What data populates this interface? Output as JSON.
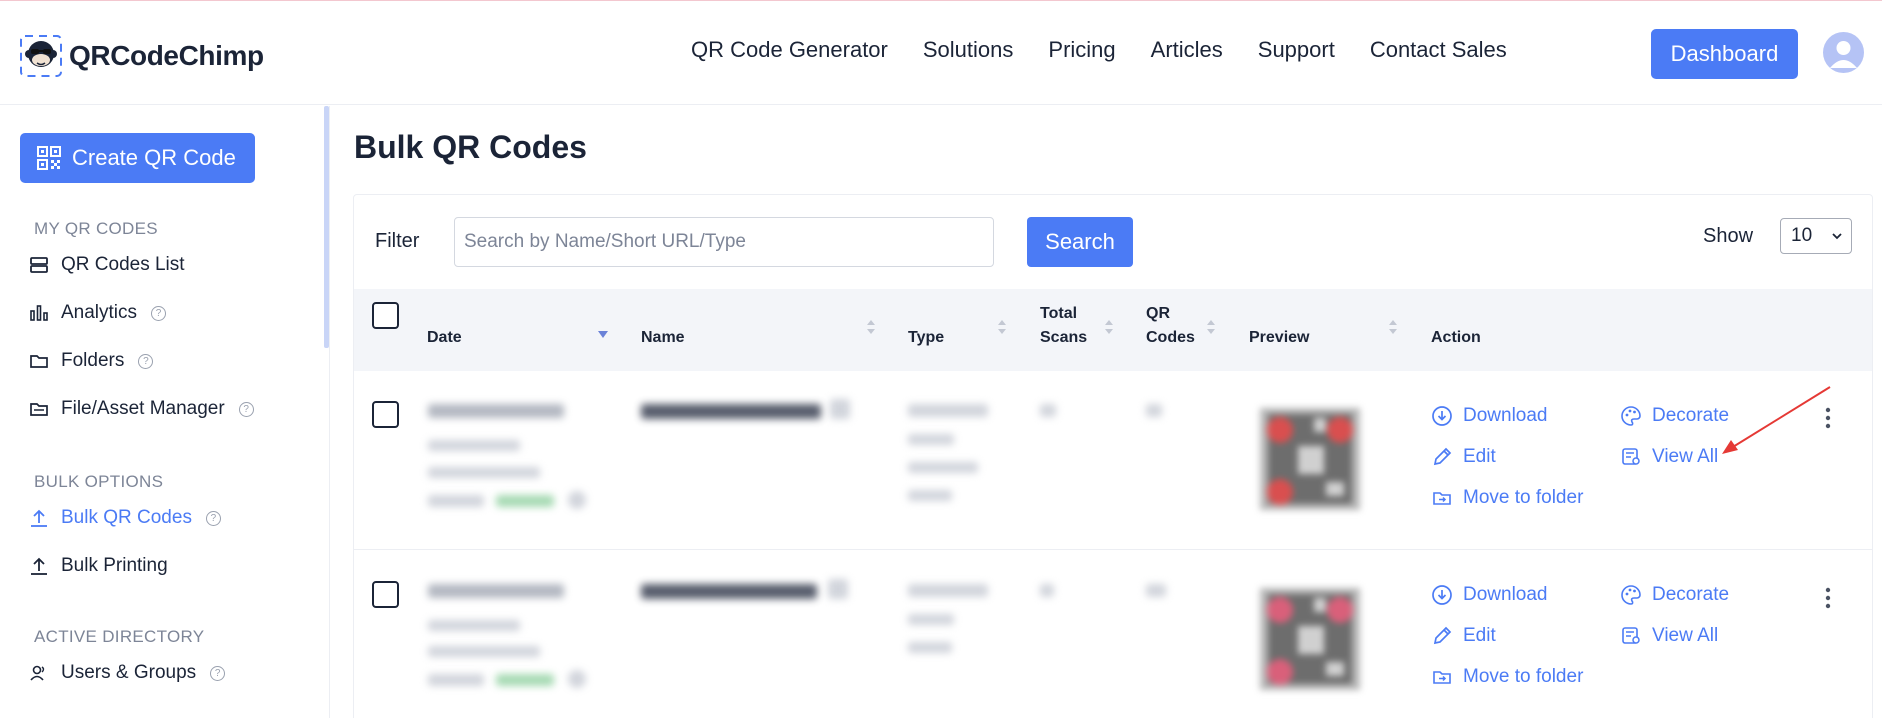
{
  "brand": {
    "name": "QRCodeChimp"
  },
  "nav": {
    "items": [
      "QR Code Generator",
      "Solutions",
      "Pricing",
      "Articles",
      "Support",
      "Contact Sales"
    ],
    "dashboard_label": "Dashboard"
  },
  "sidebar": {
    "create_label": "Create QR Code",
    "sections": [
      {
        "heading": "MY QR CODES",
        "items": [
          "QR Codes List",
          "Analytics",
          "Folders",
          "File/Asset Manager"
        ]
      },
      {
        "heading": "BULK OPTIONS",
        "items": [
          "Bulk QR Codes",
          "Bulk Printing"
        ]
      },
      {
        "heading": "ACTIVE DIRECTORY",
        "items": [
          "Users & Groups"
        ]
      }
    ],
    "active_item": "Bulk QR Codes"
  },
  "main": {
    "title": "Bulk QR Codes",
    "filter": {
      "label": "Filter",
      "placeholder": "Search by Name/Short URL/Type",
      "value": "",
      "search_label": "Search",
      "show_label": "Show",
      "show_value": "10"
    },
    "table": {
      "columns": [
        "Date",
        "Name",
        "Type",
        "Total Scans",
        "QR Codes",
        "Preview",
        "Action"
      ],
      "column_line1": {
        "scans": "Total",
        "codes": "QR"
      },
      "column_line2": {
        "scans": "Scans",
        "codes": "Codes"
      },
      "actions": {
        "download": "Download",
        "decorate": "Decorate",
        "edit": "Edit",
        "view_all": "View All",
        "move": "Move to folder"
      }
    }
  },
  "colors": {
    "accent": "#4b7bf5",
    "text": "#1b2437",
    "muted": "#7d8597",
    "header_bg": "#f3f5f9",
    "annotation": "#e53935"
  }
}
